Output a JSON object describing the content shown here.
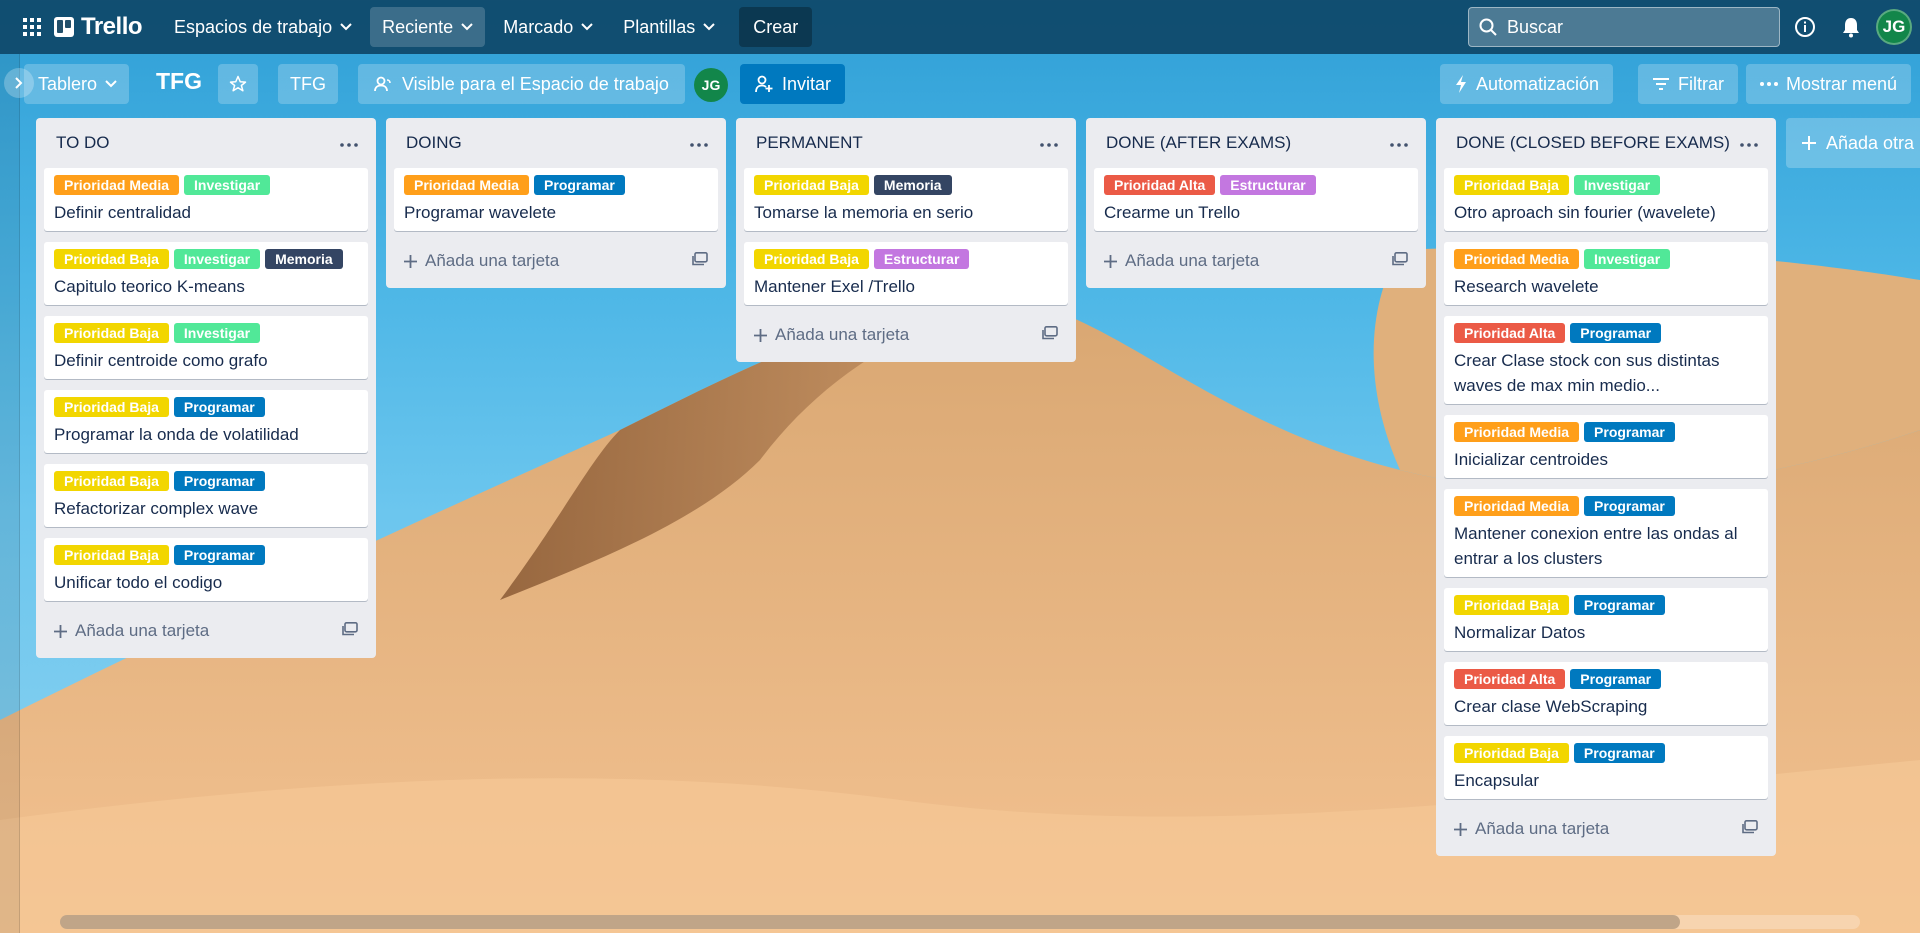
{
  "topbar": {
    "logo": "Trello",
    "nav": [
      "Espacios de trabajo",
      "Reciente",
      "Marcado",
      "Plantillas"
    ],
    "create": "Crear",
    "search_placeholder": "Buscar",
    "user_initials": "JG"
  },
  "boardbar": {
    "view": "Tablero",
    "title": "TFG",
    "workspace": "TFG",
    "visibility": "Visible para el Espacio de trabajo",
    "member_initials": "JG",
    "invite": "Invitar",
    "automation": "Automatización",
    "filter": "Filtrar",
    "menu": "Mostrar menú"
  },
  "label_colors": {
    "Prioridad Media": "#ff9f1a",
    "Prioridad Baja": "#f2d600",
    "Prioridad Alta": "#eb5a46",
    "Investigar": "#51e898",
    "Programar": "#0079bf",
    "Memoria": "#344563",
    "Estructurar": "#c377e0"
  },
  "add_card_label": "Añada una tarjeta",
  "add_list_label": "Añada otra l",
  "lists": [
    {
      "title": "TO DO",
      "cards": [
        {
          "labels": [
            "Prioridad Media",
            "Investigar"
          ],
          "title": "Definir centralidad"
        },
        {
          "labels": [
            "Prioridad Baja",
            "Investigar",
            "Memoria"
          ],
          "title": "Capitulo teorico K-means"
        },
        {
          "labels": [
            "Prioridad Baja",
            "Investigar"
          ],
          "title": "Definir centroide como grafo"
        },
        {
          "labels": [
            "Prioridad Baja",
            "Programar"
          ],
          "title": "Programar la onda de volatilidad"
        },
        {
          "labels": [
            "Prioridad Baja",
            "Programar"
          ],
          "title": "Refactorizar complex wave"
        },
        {
          "labels": [
            "Prioridad Baja",
            "Programar"
          ],
          "title": "Unificar todo el codigo"
        }
      ]
    },
    {
      "title": "DOING",
      "cards": [
        {
          "labels": [
            "Prioridad Media",
            "Programar"
          ],
          "title": "Programar wavelete"
        }
      ]
    },
    {
      "title": "PERMANENT",
      "cards": [
        {
          "labels": [
            "Prioridad Baja",
            "Memoria"
          ],
          "title": "Tomarse la memoria en serio"
        },
        {
          "labels": [
            "Prioridad Baja",
            "Estructurar"
          ],
          "title": "Mantener Exel /Trello"
        }
      ]
    },
    {
      "title": "DONE (AFTER EXAMS)",
      "cards": [
        {
          "labels": [
            "Prioridad Alta",
            "Estructurar"
          ],
          "title": "Crearme un Trello"
        }
      ]
    },
    {
      "title": "DONE (CLOSED BEFORE EXAMS)",
      "cards": [
        {
          "labels": [
            "Prioridad Baja",
            "Investigar"
          ],
          "title": "Otro aproach sin fourier (wavelete)"
        },
        {
          "labels": [
            "Prioridad Media",
            "Investigar"
          ],
          "title": "Research wavelete"
        },
        {
          "labels": [
            "Prioridad Alta",
            "Programar"
          ],
          "title": "Crear Clase stock con sus distintas waves de max min medio..."
        },
        {
          "labels": [
            "Prioridad Media",
            "Programar"
          ],
          "title": "Inicializar centroides"
        },
        {
          "labels": [
            "Prioridad Media",
            "Programar"
          ],
          "title": "Mantener conexion entre las ondas al entrar a los clusters"
        },
        {
          "labels": [
            "Prioridad Baja",
            "Programar"
          ],
          "title": "Normalizar Datos"
        },
        {
          "labels": [
            "Prioridad Alta",
            "Programar"
          ],
          "title": "Crear clase WebScraping"
        },
        {
          "labels": [
            "Prioridad Baja",
            "Programar"
          ],
          "title": "Encapsular"
        }
      ]
    }
  ]
}
